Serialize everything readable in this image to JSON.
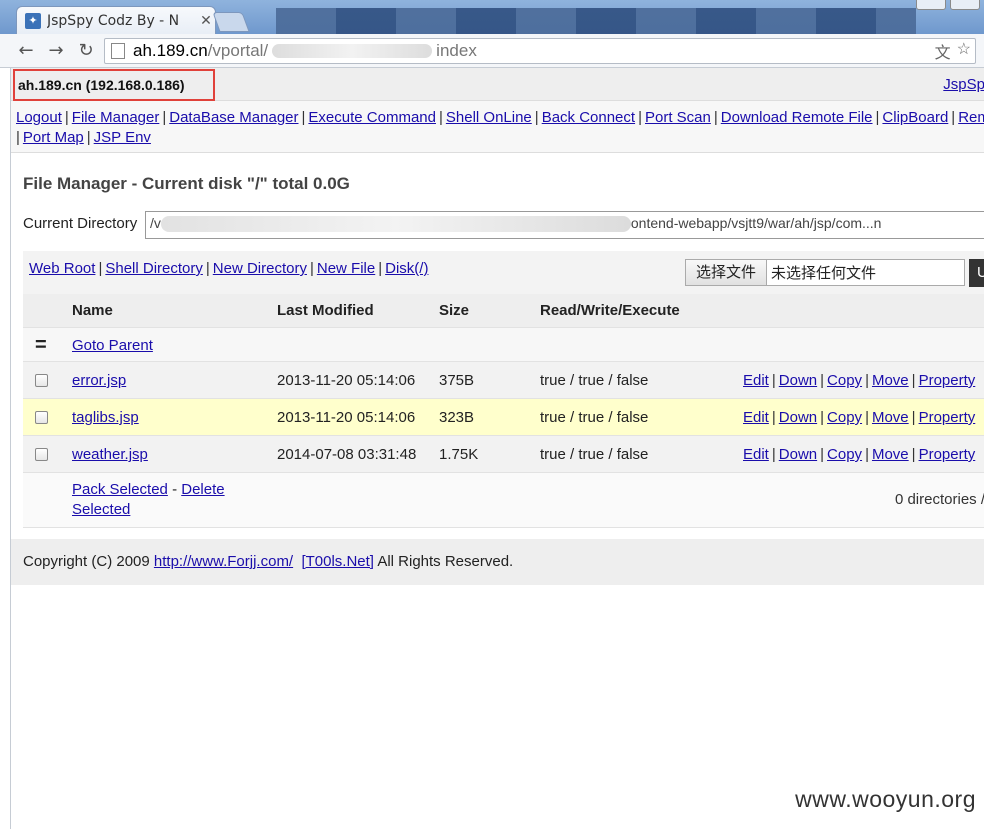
{
  "browser": {
    "tab_title": "JspSpy Codz By - N",
    "tab_close": "✕",
    "url_host": "ah.189.cn",
    "url_path_start": "/vportal/",
    "url_path_end": "index",
    "back_icon": "←",
    "forward_icon": "→",
    "reload_icon": "↻",
    "translate_icon": "文",
    "star_icon": "☆"
  },
  "header": {
    "host": "ah.189.cn (192.168.0.186)",
    "right_link": "JspSp"
  },
  "menu": {
    "items": [
      "Logout",
      "File Manager",
      "DataBase Manager",
      "Execute Command",
      "Shell OnLine",
      "Back Connect",
      "Port Scan",
      "Download Remote File",
      "ClipBoard",
      "Rem",
      "Port Map",
      "JSP Env"
    ]
  },
  "file_manager": {
    "title": "File Manager - Current disk \"/\" total 0.0G",
    "current_directory_label": "Current Directory",
    "current_directory_visible_prefix": "/v",
    "current_directory_visible_suffix": "ontend-webapp/vsjtt9/war/ah/jsp/com...n",
    "links": [
      "Web Root",
      "Shell Directory",
      "New Directory",
      "New File",
      "Disk(/)"
    ],
    "file_choose_label": "选择文件",
    "file_none_label": "未选择任何文件",
    "upload_label": "U"
  },
  "table": {
    "headers": {
      "name": "Name",
      "modified": "Last Modified",
      "size": "Size",
      "rwx": "Read/Write/Execute"
    },
    "parent": {
      "icon": "=",
      "label": "Goto Parent"
    },
    "files": [
      {
        "name": "error.jsp",
        "modified": "2013-11-20 05:14:06",
        "size": "375B",
        "rwx": "true / true / false"
      },
      {
        "name": "taglibs.jsp",
        "modified": "2013-11-20 05:14:06",
        "size": "323B",
        "rwx": "true / true / false"
      },
      {
        "name": "weather.jsp",
        "modified": "2014-07-08 03:31:48",
        "size": "1.75K",
        "rwx": "true / true / false"
      }
    ],
    "ops": [
      "Edit",
      "Down",
      "Copy",
      "Move",
      "Property"
    ],
    "footer": {
      "pack": "Pack Selected",
      "dash": "-",
      "delete": "Delete Selected",
      "summary": "0 directories /"
    }
  },
  "copyright": {
    "prefix": "Copyright (C) 2009",
    "link1": "http://www.Forjj.com/",
    "link2": "[T00ls.Net]",
    "suffix": "All Rights Reserved."
  },
  "watermark": "www.wooyun.org",
  "colors": {
    "link": "#1a0dab",
    "highlight_row": "#ffffcc",
    "host_box_border": "#e0413a"
  }
}
